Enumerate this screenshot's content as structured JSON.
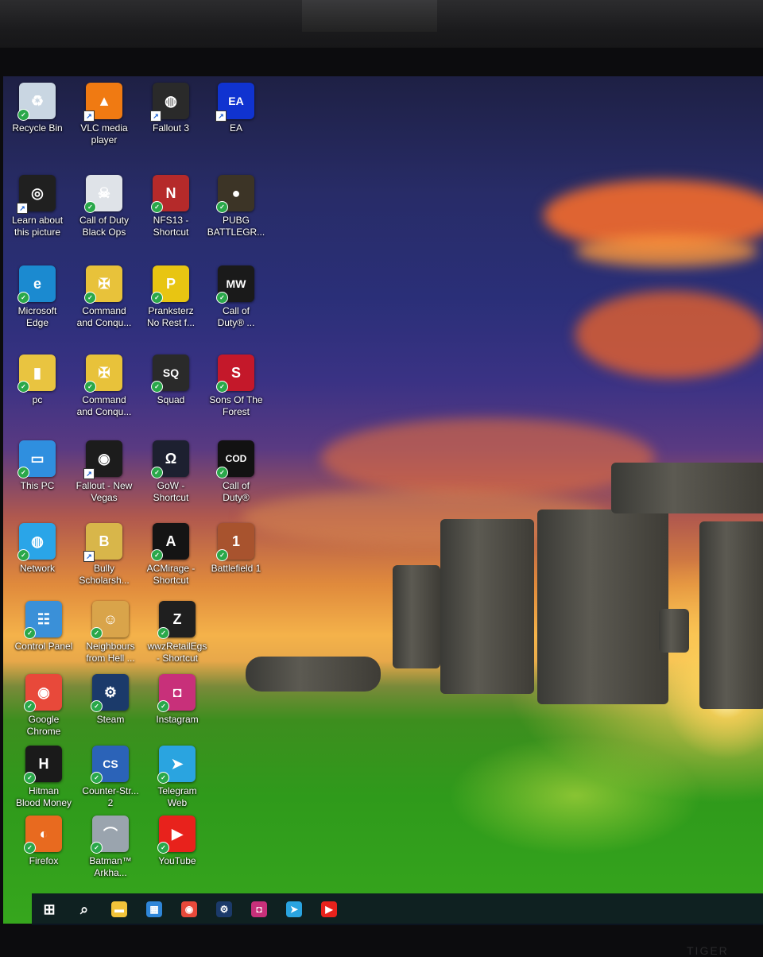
{
  "desktop": {
    "icons": [
      {
        "id": "recycle-bin",
        "label": "Recycle Bin",
        "icon": "recycle-bin-icon",
        "color": "#c9d6e2",
        "glyph": "♻"
      },
      {
        "id": "vlc",
        "label": "VLC media\nplayer",
        "icon": "vlc-cone-icon",
        "color": "#f07a12",
        "glyph": "▲"
      },
      {
        "id": "fallout3",
        "label": "Fallout 3",
        "icon": "fallout-globe-icon",
        "color": "#2a2a2a",
        "glyph": "◍"
      },
      {
        "id": "ea",
        "label": "EA",
        "icon": "ea-logo-icon",
        "color": "#1033d0",
        "glyph": "EA"
      },
      {
        "id": "learn-picture",
        "label": "Learn about\nthis picture",
        "icon": "camera-info-icon",
        "color": "#202020",
        "glyph": "◎"
      },
      {
        "id": "cod-bo",
        "label": "Call of Duty\nBlack Ops",
        "icon": "skull-icon",
        "color": "#dfe3e8",
        "glyph": "☠"
      },
      {
        "id": "nfs13",
        "label": "NFS13 -\nShortcut",
        "icon": "nfs-car-icon",
        "color": "#b52a2a",
        "glyph": "N"
      },
      {
        "id": "pubg",
        "label": "PUBG\nBATTLEGR...",
        "icon": "pubg-helmet-icon",
        "color": "#3c3426",
        "glyph": "●"
      },
      {
        "id": "edge",
        "label": "Microsoft\nEdge",
        "icon": "edge-browser-icon",
        "color": "#1b8ad0",
        "glyph": "e"
      },
      {
        "id": "cnc1",
        "label": "Command\nand Conqu...",
        "icon": "cnc-eagle-icon",
        "color": "#e8c23a",
        "glyph": "✠"
      },
      {
        "id": "pranksterz",
        "label": "Pranksterz\nNo Rest f...",
        "icon": "pranksterz-icon",
        "color": "#e8c512",
        "glyph": "P"
      },
      {
        "id": "cod-mw",
        "label": "Call of\nDuty® ...",
        "icon": "mw-logo-icon",
        "color": "#1a1a1a",
        "glyph": "MW"
      },
      {
        "id": "pc-folder",
        "label": "pc",
        "icon": "user-folder-icon",
        "color": "#e9c440",
        "glyph": "▮"
      },
      {
        "id": "cnc2",
        "label": "Command\nand Conqu...",
        "icon": "cnc-eagle-icon",
        "color": "#e8c23a",
        "glyph": "✠"
      },
      {
        "id": "squad",
        "label": "Squad",
        "icon": "squad-logo-icon",
        "color": "#2a2a2a",
        "glyph": "SQ"
      },
      {
        "id": "sons-forest",
        "label": "Sons Of The\nForest",
        "icon": "sons-forest-icon",
        "color": "#c4182a",
        "glyph": "S"
      },
      {
        "id": "this-pc",
        "label": "This PC",
        "icon": "monitor-icon",
        "color": "#2f8fdf",
        "glyph": "▭"
      },
      {
        "id": "fallout-nv",
        "label": "Fallout - New\nVegas",
        "icon": "fallout-nv-icon",
        "color": "#1c1c1c",
        "glyph": "◉"
      },
      {
        "id": "gow",
        "label": "GoW -\nShortcut",
        "icon": "omega-icon",
        "color": "#1d2030",
        "glyph": "Ω"
      },
      {
        "id": "cod",
        "label": "Call of\nDuty®",
        "icon": "cod-logo-icon",
        "color": "#121212",
        "glyph": "COD"
      },
      {
        "id": "network",
        "label": "Network",
        "icon": "network-globe-icon",
        "color": "#2aa5e8",
        "glyph": "◍"
      },
      {
        "id": "bully",
        "label": "Bully\nScholarsh...",
        "icon": "bully-b-icon",
        "color": "#d8b64a",
        "glyph": "B"
      },
      {
        "id": "acmirage",
        "label": "ACMirage -\nShortcut",
        "icon": "assassins-creed-icon",
        "color": "#141414",
        "glyph": "A"
      },
      {
        "id": "bf1",
        "label": "Battlefield 1",
        "icon": "battlefield-soldier-icon",
        "color": "#a8532e",
        "glyph": "1"
      },
      {
        "id": "control-panel",
        "label": "Control Panel",
        "icon": "control-panel-icon",
        "color": "#3a90d8",
        "glyph": "☷"
      },
      {
        "id": "neighbours",
        "label": "Neighbours\nfrom Hell ...",
        "icon": "neighbours-face-icon",
        "color": "#d9a44a",
        "glyph": "☺"
      },
      {
        "id": "wwz",
        "label": "wwzRetailEgs\n- Shortcut",
        "icon": "wwz-z-icon",
        "color": "#1f1f1f",
        "glyph": "Z"
      },
      {
        "id": "chrome",
        "label": "Google\nChrome",
        "icon": "chrome-icon",
        "color": "#e8493a",
        "glyph": "◉"
      },
      {
        "id": "steam",
        "label": "Steam",
        "icon": "steam-icon",
        "color": "#1b3a6a",
        "glyph": "⚙"
      },
      {
        "id": "instagram",
        "label": "Instagram",
        "icon": "instagram-icon",
        "color": "#c8307a",
        "glyph": "◘"
      },
      {
        "id": "hitman",
        "label": "Hitman\nBlood Money",
        "icon": "hitman-icon",
        "color": "#1a1a1a",
        "glyph": "H"
      },
      {
        "id": "cs2",
        "label": "Counter-Str...\n2",
        "icon": "counter-strike-icon",
        "color": "#2b63b8",
        "glyph": "CS"
      },
      {
        "id": "telegram",
        "label": "Telegram\nWeb",
        "icon": "telegram-icon",
        "color": "#2aa4e0",
        "glyph": "➤"
      },
      {
        "id": "firefox",
        "label": "Firefox",
        "icon": "firefox-icon",
        "color": "#e86a1f",
        "glyph": "◐"
      },
      {
        "id": "batman",
        "label": "Batman™\nArkha...",
        "icon": "batman-icon",
        "color": "#9aa4ae",
        "glyph": "⌒"
      },
      {
        "id": "youtube",
        "label": "YouTube",
        "icon": "youtube-icon",
        "color": "#e8221c",
        "glyph": "▶"
      }
    ]
  },
  "taskbar": {
    "items": [
      {
        "id": "start",
        "icon": "windows-start-icon",
        "color": "#ffffff",
        "glyph": "⊞"
      },
      {
        "id": "search",
        "icon": "search-icon",
        "color": "#ffffff",
        "glyph": "⌕"
      },
      {
        "id": "explorer",
        "icon": "file-explorer-icon",
        "color": "#f2c33a",
        "glyph": "▬"
      },
      {
        "id": "store",
        "icon": "store-icon",
        "color": "#2f86d8",
        "glyph": "▦"
      },
      {
        "id": "chrome",
        "icon": "chrome-icon",
        "color": "#e8493a",
        "glyph": "◉"
      },
      {
        "id": "steam",
        "icon": "steam-icon",
        "color": "#1b3a6a",
        "glyph": "⚙"
      },
      {
        "id": "instagram",
        "icon": "instagram-icon",
        "color": "#c8307a",
        "glyph": "◘"
      },
      {
        "id": "telegram",
        "icon": "telegram-icon",
        "color": "#2aa4e0",
        "glyph": "➤"
      },
      {
        "id": "youtube",
        "icon": "youtube-icon",
        "color": "#e8221c",
        "glyph": "▶"
      }
    ]
  },
  "monitor": {
    "brand": "TIGER"
  }
}
